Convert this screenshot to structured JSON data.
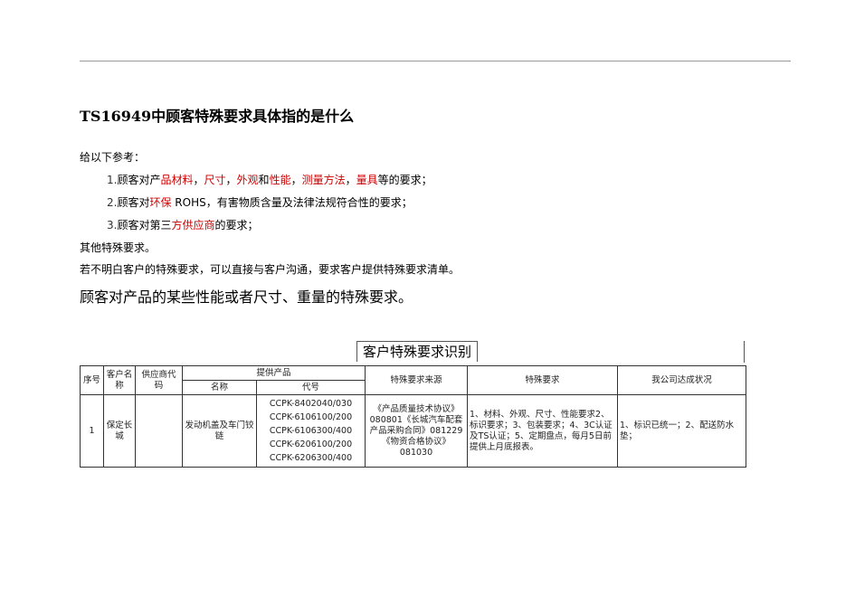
{
  "doc": {
    "title": "TS16949中顾客特殊要求具体指的是什么",
    "intro": "给以下参考：",
    "items": [
      {
        "num": "1.",
        "parts": [
          {
            "t": "顾客对产",
            "red": false
          },
          {
            "t": "品材料",
            "red": true
          },
          {
            "t": "，",
            "red": false
          },
          {
            "t": "尺寸",
            "red": true
          },
          {
            "t": "，",
            "red": false
          },
          {
            "t": "外观",
            "red": true
          },
          {
            "t": "和",
            "red": false
          },
          {
            "t": "性能",
            "red": true
          },
          {
            "t": "，",
            "red": false
          },
          {
            "t": "测量方法",
            "red": true
          },
          {
            "t": "，",
            "red": false
          },
          {
            "t": "量具",
            "red": true
          },
          {
            "t": "等的要求；",
            "red": false
          }
        ]
      },
      {
        "num": "2.",
        "parts": [
          {
            "t": "顾客对",
            "red": false
          },
          {
            "t": "环保",
            "red": true
          },
          {
            "t": " ROHS，有害物质含量及法律法规符合性的要求；",
            "red": false
          }
        ]
      },
      {
        "num": "3.",
        "parts": [
          {
            "t": "顾客对第三",
            "red": false
          },
          {
            "t": "方供应商",
            "red": true
          },
          {
            "t": "的要求；",
            "red": false
          }
        ]
      }
    ],
    "other": "其他特殊要求。",
    "advice": "若不明白客户的特殊要求，可以直接与客户沟通，要求客户提供特殊要求清单。",
    "big_line": "顾客对产品的某些性能或者尺寸、重量的特殊要求。"
  },
  "scan": {
    "title": "客户特殊要求识别",
    "headers": {
      "seq": "序号",
      "customer": "客户名称",
      "supplier_code": "供应商代码",
      "product": "提供产品",
      "name": "名称",
      "code": "代号",
      "source": "特殊要求来源",
      "requirement": "特殊要求",
      "status": "我公司达成状况"
    },
    "row": {
      "seq": "1",
      "customer": "保定长城",
      "supplier_code": "",
      "name": "发动机盖及车门铰链",
      "codes": [
        "CCPK-8402040/030",
        "CCPK-6106100/200",
        "CCPK-6106300/400",
        "CCPK-6206100/200",
        "CCPK-6206300/400"
      ],
      "source": "《产品质量技术协议》080801《长城汽车配套产品采购合同》081229《物资合格协议》081030",
      "requirement": "1、材料、外观、尺寸、性能要求2、标识要求；3、包装要求；4、3C认证及TS认证；5、定期盘点，每月5日前提供上月底报表。",
      "status": "1、标识已统一；2、配送防水垫；"
    }
  }
}
